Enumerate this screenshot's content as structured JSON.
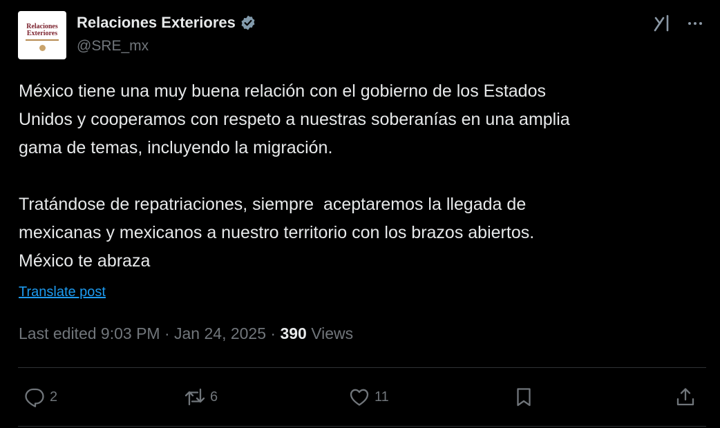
{
  "author": {
    "display_name": "Relaciones Exteriores",
    "handle": "@SRE_mx",
    "avatar_text": "Relaciones Exteriores",
    "verified_icon": "verified-badge-icon"
  },
  "post": {
    "body": "México tiene una muy buena relación con el gobierno de los Estados\nUnidos y cooperamos con respeto a nuestras soberanías en una amplia\ngama de temas, incluyendo la migración.\n\nTratándose de repatriaciones, siempre  aceptaremos la llegada de\nmexicanas y mexicanos a nuestro territorio con los brazos abiertos.\nMéxico te abraza",
    "translate_label": "Translate post",
    "meta_prefix": "Last edited 9:03 PM · Jan 24, 2025 · ",
    "views_count": "390",
    "views_label": " Views"
  },
  "actions": {
    "replies": "2",
    "reposts": "6",
    "likes": "11"
  },
  "colors": {
    "background": "#000000",
    "text": "#e7e9ea",
    "muted": "#71767b",
    "link": "#1d9bf0",
    "divider": "#2f3336"
  }
}
